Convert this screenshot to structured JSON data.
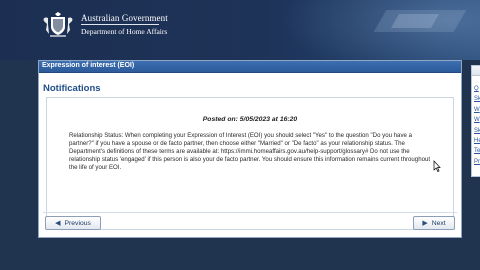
{
  "header": {
    "gov_name": "Australian Government",
    "department": "Department of Home Affairs",
    "icons": {
      "crest": "coat-of-arms-icon"
    }
  },
  "panel": {
    "header_title": "Expression of interest (EOI)",
    "title": "Notifications",
    "posted": "Posted on: 5/05/2023 at 16:20",
    "message": "Relationship Status: When completing your Expression of Interest (EOI) you should select \"Yes\" to the question \"Do you have a partner?\" if you have a spouse or de facto partner, then choose either \"Married\" or \"De facto\" as your relationship status. The Department's definitions of these terms are available at: https://immi.homeaffairs.gov.au/help-support/glossary# Do not use the relationship status 'engaged' if this person is also your de facto partner. You should ensure this information remains current throughout the life of your EOI."
  },
  "navigation": {
    "previous_label": "Previous",
    "next_label": "Next",
    "icons": {
      "previous": "chevron-left-icon",
      "next": "chevron-right-icon"
    }
  },
  "side_panel": {
    "links": [
      "Q",
      "Sk",
      "W",
      "W",
      "Sk",
      "He",
      "Te",
      "Pr"
    ]
  },
  "colors": {
    "banner": "#1c2f52",
    "panel_header": "#3d6fb1",
    "title": "#1f4f8a",
    "link": "#2a55a0"
  }
}
